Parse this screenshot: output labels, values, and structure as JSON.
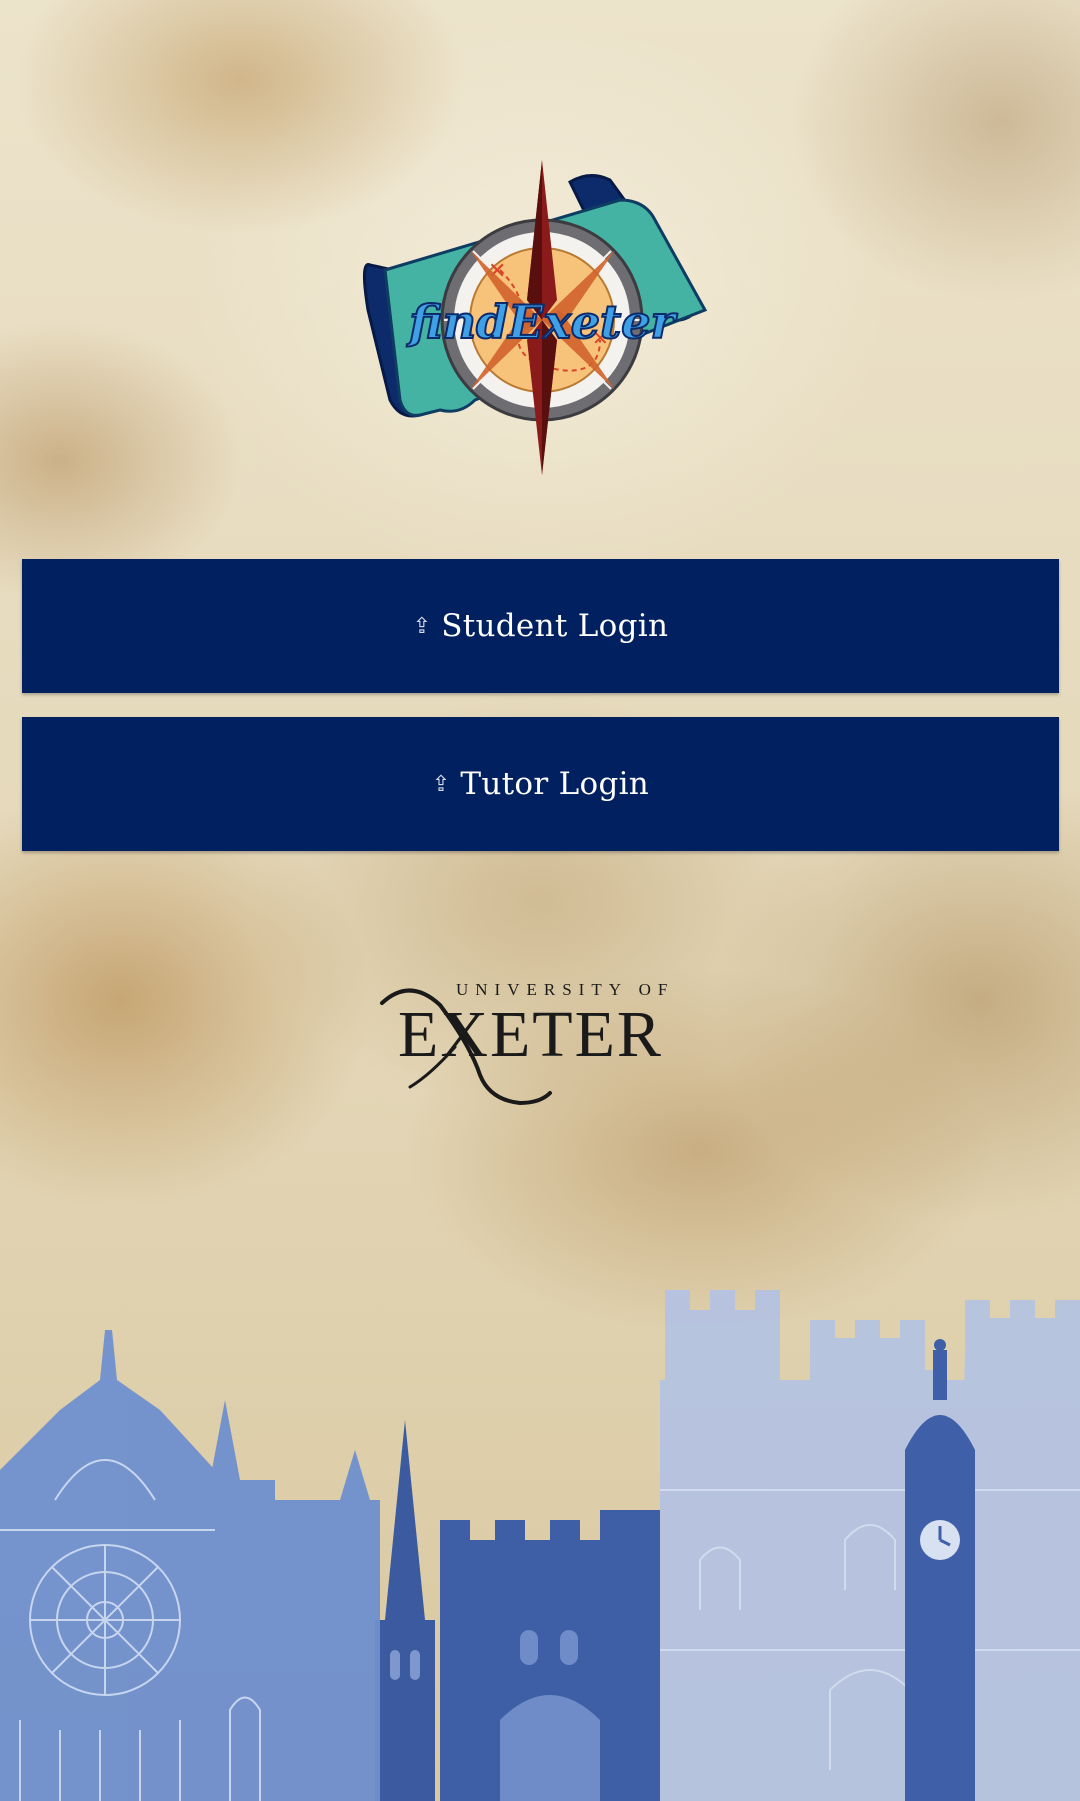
{
  "app": {
    "logo_text": "findExeter"
  },
  "buttons": {
    "student_icon": "⇪",
    "student_label": "Student Login",
    "tutor_icon": "⇪",
    "tutor_label": "Tutor Login"
  },
  "university_logo": {
    "line1": "UNIVERSITY OF",
    "line2": "EXETER"
  },
  "colors": {
    "button_bg": "#012060",
    "button_text": "#ffffff",
    "skyline_light": "#a8b9dd",
    "skyline_dark": "#3e5fa6"
  },
  "icons": {
    "app_logo": "compass-scroll-logo",
    "login_icon": "key-icon",
    "background": "city-skyline"
  }
}
